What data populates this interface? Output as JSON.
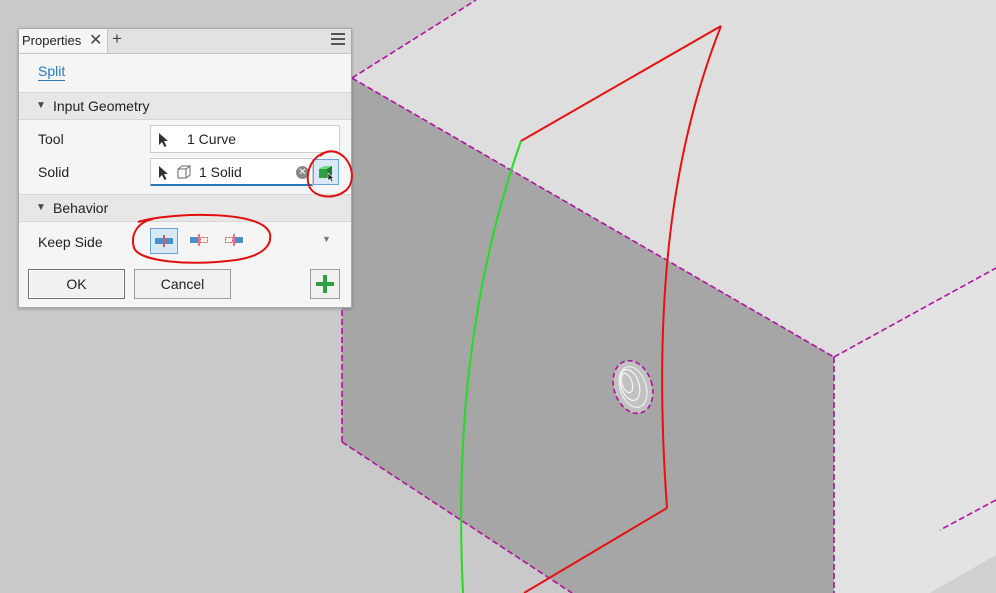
{
  "panel": {
    "tab_title": "Properties",
    "tab_close_glyph": "✕",
    "tab_add_glyph": "+",
    "menu_icon": "hamburger-icon",
    "feature_link": "Split"
  },
  "input_geometry": {
    "header": "Input Geometry",
    "tool_label": "Tool",
    "tool_value": "1 Curve",
    "solid_label": "Solid",
    "solid_value": "1 Solid"
  },
  "behavior": {
    "header": "Behavior",
    "keep_side_label": "Keep Side",
    "options": [
      "keep-both-sides-icon",
      "keep-side-a-icon",
      "keep-side-b-icon"
    ],
    "selected_option": "keep-both-sides-icon"
  },
  "buttons": {
    "ok": "OK",
    "cancel": "Cancel",
    "apply_icon": "plus-icon"
  },
  "colors": {
    "accent_blue": "#2a7ab8",
    "apply_green": "#2ea043",
    "model_edge_magenta": "#b0139f",
    "split_curve_red": "#e81010",
    "split_curve_green": "#22dd22",
    "annotation_red": "#e01010"
  }
}
